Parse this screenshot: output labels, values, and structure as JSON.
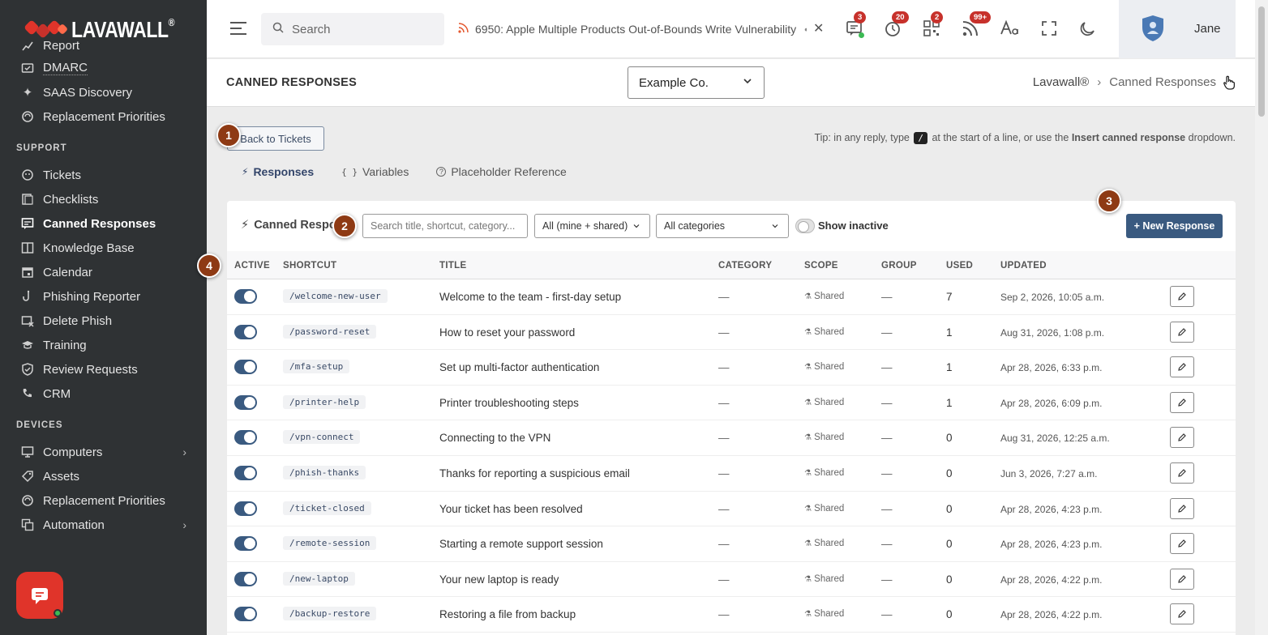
{
  "brand": {
    "name": "LAVAWALL",
    "reg": "®"
  },
  "sidebar": {
    "top_items": [
      {
        "label": "Report",
        "icon": "report-icon"
      },
      {
        "label": "DMARC",
        "icon": "mail-check-icon"
      },
      {
        "label": "SAAS Discovery",
        "icon": "sparkle-icon"
      },
      {
        "label": "Replacement Priorities",
        "icon": "cycle-icon"
      }
    ],
    "support_header": "SUPPORT",
    "support_items": [
      {
        "label": "Tickets",
        "icon": "headset-icon"
      },
      {
        "label": "Checklists",
        "icon": "checklist-icon"
      },
      {
        "label": "Canned Responses",
        "icon": "chat-icon",
        "active": true
      },
      {
        "label": "Knowledge Base",
        "icon": "book-icon"
      },
      {
        "label": "Calendar",
        "icon": "calendar-icon"
      },
      {
        "label": "Phishing Reporter",
        "icon": "hook-icon"
      },
      {
        "label": "Delete Phish",
        "icon": "delete-mail-icon"
      },
      {
        "label": "Training",
        "icon": "graduation-icon"
      },
      {
        "label": "Review Requests",
        "icon": "shield-check-icon"
      },
      {
        "label": "CRM",
        "icon": "phone-list-icon"
      }
    ],
    "devices_header": "DEVICES",
    "device_items": [
      {
        "label": "Computers",
        "icon": "monitor-icon",
        "has_children": true
      },
      {
        "label": "Assets",
        "icon": "tag-icon"
      },
      {
        "label": "Replacement Priorities",
        "icon": "cycle-icon"
      },
      {
        "label": "Automation",
        "icon": "automation-icon",
        "has_children": true
      }
    ]
  },
  "topbar": {
    "search_placeholder": "Search",
    "ticker_text": "6950: Apple Multiple Products Out-of-Bounds Write Vulnerability",
    "ticker_dot": "•",
    "close_symbol": "✕",
    "badges": {
      "messages": "3",
      "timer": "20",
      "qr": "2",
      "feeds": "99+"
    },
    "user_name": "Jane"
  },
  "page": {
    "title": "CANNED RESPONSES",
    "company_select": "Example Co.",
    "breadcrumb": {
      "root": "Lavawall®",
      "sep": "›",
      "current": "Canned Responses"
    }
  },
  "content": {
    "back_button": "Back to Tickets",
    "tip": {
      "prefix": "Tip: in any reply, type",
      "key": "/",
      "middle": "at the start of a line, or use the",
      "bold": "Insert canned response",
      "suffix": "dropdown."
    },
    "tabs": [
      {
        "label": "Responses",
        "icon": "⚡",
        "active": true
      },
      {
        "label": "Variables",
        "icon": "{ }"
      },
      {
        "label": "Placeholder Reference",
        "icon": "?"
      }
    ],
    "card_title": "Canned Respo",
    "filter_search_placeholder": "Search title, shortcut, category...",
    "owner_filter": "All (mine + shared)",
    "category_filter": "All categories",
    "show_inactive": "Show inactive",
    "new_button": "+ New Response"
  },
  "table": {
    "headers": [
      "ACTIVE",
      "SHORTCUT",
      "TITLE",
      "CATEGORY",
      "SCOPE",
      "GROUP",
      "USED",
      "UPDATED"
    ],
    "rows": [
      {
        "shortcut": "/welcome-new-user",
        "title": "Welcome to the team - first-day setup",
        "category": "—",
        "scope": "Shared",
        "group": "—",
        "used": "7",
        "updated": "Sep 2, 2026, 10:05 a.m."
      },
      {
        "shortcut": "/password-reset",
        "title": "How to reset your password",
        "category": "—",
        "scope": "Shared",
        "group": "—",
        "used": "1",
        "updated": "Aug 31, 2026, 1:08 p.m."
      },
      {
        "shortcut": "/mfa-setup",
        "title": "Set up multi-factor authentication",
        "category": "—",
        "scope": "Shared",
        "group": "—",
        "used": "1",
        "updated": "Apr 28, 2026, 6:33 p.m."
      },
      {
        "shortcut": "/printer-help",
        "title": "Printer troubleshooting steps",
        "category": "—",
        "scope": "Shared",
        "group": "—",
        "used": "1",
        "updated": "Apr 28, 2026, 6:09 p.m."
      },
      {
        "shortcut": "/vpn-connect",
        "title": "Connecting to the VPN",
        "category": "—",
        "scope": "Shared",
        "group": "—",
        "used": "0",
        "updated": "Aug 31, 2026, 12:25 a.m."
      },
      {
        "shortcut": "/phish-thanks",
        "title": "Thanks for reporting a suspicious email",
        "category": "—",
        "scope": "Shared",
        "group": "—",
        "used": "0",
        "updated": "Jun 3, 2026, 7:27 a.m."
      },
      {
        "shortcut": "/ticket-closed",
        "title": "Your ticket has been resolved",
        "category": "—",
        "scope": "Shared",
        "group": "—",
        "used": "0",
        "updated": "Apr 28, 2026, 4:23 p.m."
      },
      {
        "shortcut": "/remote-session",
        "title": "Starting a remote support session",
        "category": "—",
        "scope": "Shared",
        "group": "—",
        "used": "0",
        "updated": "Apr 28, 2026, 4:23 p.m."
      },
      {
        "shortcut": "/new-laptop",
        "title": "Your new laptop is ready",
        "category": "—",
        "scope": "Shared",
        "group": "—",
        "used": "0",
        "updated": "Apr 28, 2026, 4:22 p.m."
      },
      {
        "shortcut": "/backup-restore",
        "title": "Restoring a file from backup",
        "category": "—",
        "scope": "Shared",
        "group": "—",
        "used": "0",
        "updated": "Apr 28, 2026, 4:22 p.m."
      }
    ]
  },
  "callouts": [
    "1",
    "2",
    "3",
    "4"
  ],
  "colors": {
    "sidebar_bg": "#2f3234",
    "accent": "#3a5a80",
    "brand_red": "#e0342a",
    "callout": "#8e3a14",
    "badge": "#c7312b"
  }
}
